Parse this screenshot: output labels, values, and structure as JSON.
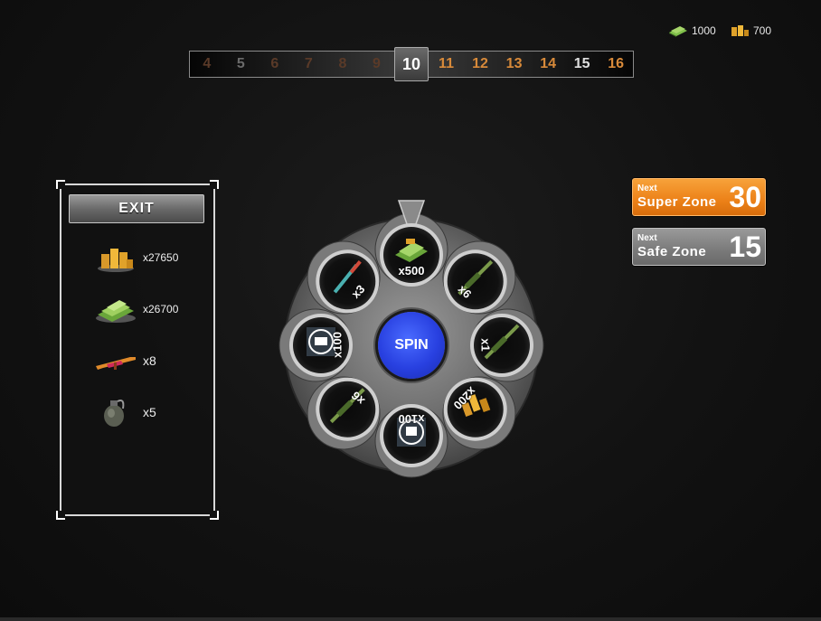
{
  "currency": {
    "cash": {
      "icon": "cash-icon",
      "value": "1000"
    },
    "gold": {
      "icon": "gold-bars-icon",
      "value": "700"
    }
  },
  "zone_bar": {
    "zones": [
      "4",
      "5",
      "6",
      "7",
      "8",
      "9",
      "10",
      "11",
      "12",
      "13",
      "14",
      "15",
      "16"
    ],
    "current": "10"
  },
  "rewards_panel": {
    "exit_label": "EXIT",
    "items": [
      {
        "icon": "gold-bars-icon",
        "amount": "x27650"
      },
      {
        "icon": "cash-icon",
        "amount": "x26700"
      },
      {
        "icon": "rifle-icon",
        "amount": "x8"
      },
      {
        "icon": "grenade-icon",
        "amount": "x5"
      }
    ]
  },
  "next_super": {
    "small": "Next",
    "label": "Super Zone",
    "value": "30"
  },
  "next_safe": {
    "small": "Next",
    "label": "Safe Zone",
    "value": "15"
  },
  "wheel": {
    "spin_label": "SPIN",
    "slots": [
      {
        "icon": "cash-icon",
        "label": "x500"
      },
      {
        "icon": "rifle-icon",
        "label": "x6"
      },
      {
        "icon": "rifle-icon",
        "label": "x1"
      },
      {
        "icon": "gold-bars-icon",
        "label": "x200"
      },
      {
        "icon": "gold-chest-icon",
        "label": "x100"
      },
      {
        "icon": "rifle-icon",
        "label": "x6"
      },
      {
        "icon": "cash-chest-icon",
        "label": "x100"
      },
      {
        "icon": "knife-icon",
        "label": "x3"
      }
    ]
  },
  "colors": {
    "accent_orange": "#ec8118",
    "spin_blue": "#2840e0",
    "zone_future": "#d88a3a"
  }
}
